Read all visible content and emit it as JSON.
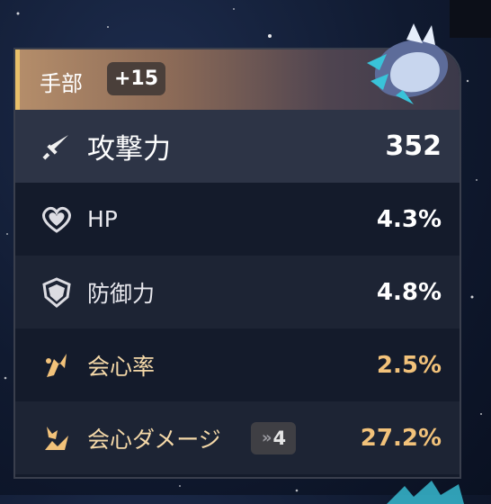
{
  "header": {
    "slot": "手部",
    "level": "+15"
  },
  "stats": [
    {
      "name": "攻撃力",
      "value": "352",
      "icon": "sword-icon",
      "kind": "main"
    },
    {
      "name": "HP",
      "value": "4.3%",
      "icon": "heart-icon",
      "kind": "sub"
    },
    {
      "name": "防御力",
      "value": "4.8%",
      "icon": "shield-icon",
      "kind": "sub"
    },
    {
      "name": "会心率",
      "value": "2.5%",
      "icon": "crit-rate-icon",
      "kind": "crit"
    },
    {
      "name": "会心ダメージ",
      "value": "27.2%",
      "icon": "crit-damage-icon",
      "kind": "crit",
      "upgrade_count": "4"
    }
  ],
  "colors": {
    "crit_gold": "#f2c27a",
    "header_accent": "#e8c06a"
  }
}
